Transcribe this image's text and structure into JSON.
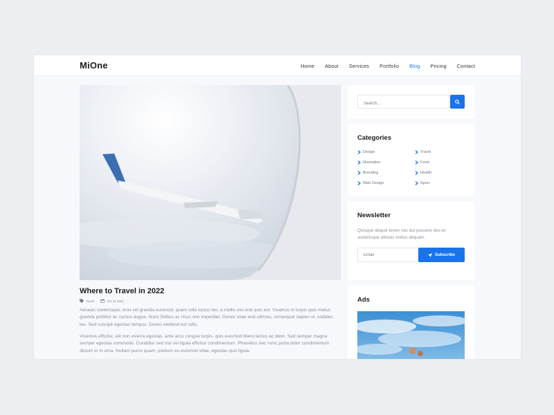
{
  "header": {
    "logo": "MiOne",
    "nav": [
      {
        "label": "Home",
        "active": false
      },
      {
        "label": "About",
        "active": false
      },
      {
        "label": "Services",
        "active": false
      },
      {
        "label": "Portfolio",
        "active": false
      },
      {
        "label": "Blog",
        "active": true
      },
      {
        "label": "Pricing",
        "active": false
      },
      {
        "label": "Contact",
        "active": false
      }
    ]
  },
  "post": {
    "title": "Where to Travel in 2022",
    "category": "Travel",
    "date": "Oct 21 2021",
    "paragraphs": [
      "Aenean scelerisque, eros vel gravida euismod, quam odio luctus leo, a mollis nisi erat quis est. Vivamus in turpis quis metus gravida porttitor ac cursus augue. Nunc finibus ac risus non imperdiet. Donec vitae erat ultrices, consequat sapien ut, sodales leo. Sed suscipit egestas tempus. Donec eleifend est odio.",
      "Vivamus efficitur, elit non viverra egestas, ante arcu congue turpis, quis euismod libero lectus ac dolor. Sed semper magna semper egestas commodo. Curabitur sed nisi vel ligula efficitur condimentum. Phasellus nec nunc porta dolor condimentum dictum in in urna. Nullam purus quam, pretium eu euismod vitae, egestas quis ligula."
    ]
  },
  "sidebar": {
    "search": {
      "placeholder": "Search..."
    },
    "categories": {
      "title": "Categories",
      "left": [
        "Design",
        "Illustration",
        "Branding",
        "Web Design"
      ],
      "right": [
        "Travel",
        "Food",
        "Health",
        "Sport"
      ]
    },
    "newsletter": {
      "title": "Newsletter",
      "text": "Quisque aliquet lorem nec dui posuere des et, scelerisque ultrices metus aliquam.",
      "email_placeholder": "Email",
      "button": "Subscribe"
    },
    "ads": {
      "title": "Ads"
    }
  },
  "colors": {
    "accent": "#1a73e8",
    "frame": "#f6f8fb",
    "page": "#eceef1"
  }
}
